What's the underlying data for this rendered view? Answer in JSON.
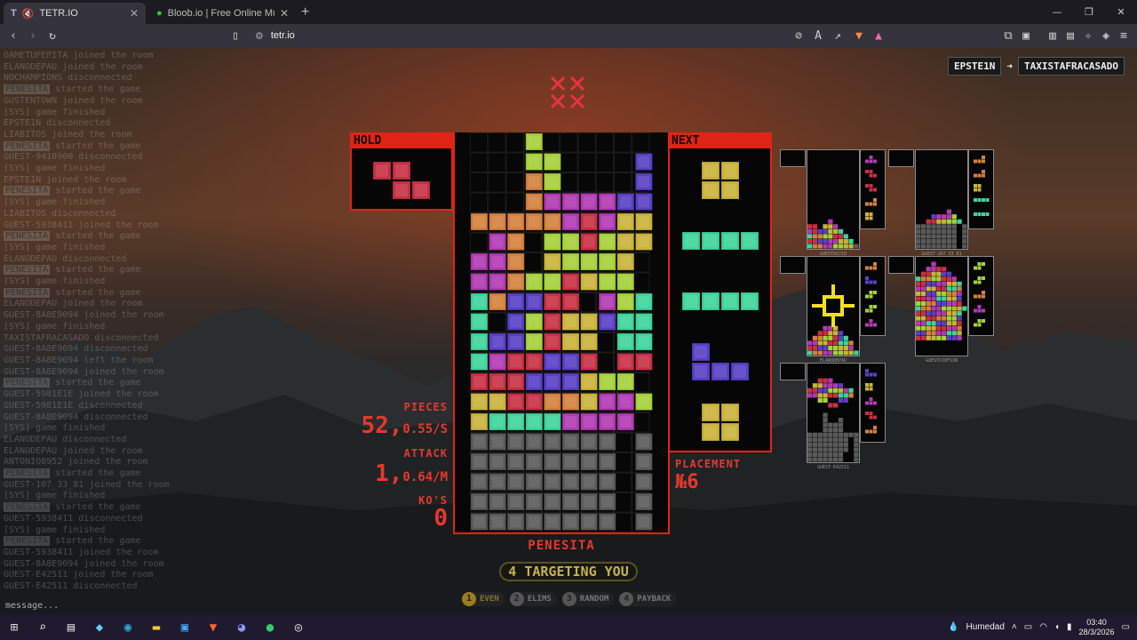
{
  "browser": {
    "tabs": [
      {
        "title": "TETR.IO",
        "active": true
      },
      {
        "title": "Bloob.io | Free Online Multiplayer Ga",
        "active": false
      }
    ],
    "url": "tetr.io",
    "window_controls": [
      "—",
      "❐",
      "✕"
    ]
  },
  "chat": {
    "lines": [
      {
        "tag": "",
        "text": "OAMETUPEPITA joined the room"
      },
      {
        "tag": "",
        "text": "ELANODEPAU joined the room"
      },
      {
        "tag": "",
        "text": "NOCHAMPIONS disconnected"
      },
      {
        "tag": "PENESITA",
        "text": " started the game"
      },
      {
        "tag": "",
        "text": "GUSTENTOWN joined the room"
      },
      {
        "tag": "",
        "text": "[SYS] game finished"
      },
      {
        "tag": "",
        "text": "EPSTE1N disconnected"
      },
      {
        "tag": "",
        "text": "LIABITOS joined the room"
      },
      {
        "tag": "PENESITA",
        "text": " started the game"
      },
      {
        "tag": "",
        "text": "GUEST-9410900 disconnected"
      },
      {
        "tag": "",
        "text": "[SYS] game finished"
      },
      {
        "tag": "",
        "text": "EPSTE1N joined the room"
      },
      {
        "tag": "PENESITA",
        "text": " started the game"
      },
      {
        "tag": "",
        "text": "[SYS] game finished"
      },
      {
        "tag": "",
        "text": "LIABITOS disconnected"
      },
      {
        "tag": "",
        "text": "GUEST-5938411 joined the room"
      },
      {
        "tag": "PENESITA",
        "text": " started the game"
      },
      {
        "tag": "",
        "text": "[SYS] game finished"
      },
      {
        "tag": "",
        "text": "ELANODEPAU disconnected"
      },
      {
        "tag": "PENESITA",
        "text": " started the game"
      },
      {
        "tag": "",
        "text": "[SYS] game finished"
      },
      {
        "tag": "PENESITA",
        "text": " started the game"
      },
      {
        "tag": "",
        "text": "ELANODEPAU joined the room"
      },
      {
        "tag": "",
        "text": "GUEST-8A8E9094 joined the room"
      },
      {
        "tag": "",
        "text": "[SYS] game finished"
      },
      {
        "tag": "",
        "text": "TAXISTAFRACASADO disconnected"
      },
      {
        "tag": "",
        "text": "GUEST-8A8E9094 disconnected"
      },
      {
        "tag": "",
        "text": "GUEST-8A8E9094 left the room"
      },
      {
        "tag": "",
        "text": "GUEST-8A8E9094 joined the room"
      },
      {
        "tag": "PENESITA",
        "text": " started the game"
      },
      {
        "tag": "",
        "text": "GUEST-5981E1E joined the room"
      },
      {
        "tag": "",
        "text": "GUEST-5981E1E disconnected"
      },
      {
        "tag": "",
        "text": "GUEST-8A8E9094 disconnected"
      },
      {
        "tag": "",
        "text": "[SYS] game finished"
      },
      {
        "tag": "",
        "text": "ELANODEPAU disconnected"
      },
      {
        "tag": "",
        "text": "ELANODEPAU joined the room"
      },
      {
        "tag": "",
        "text": "ANTONIO8952 joined the room"
      },
      {
        "tag": "PENESITA",
        "text": " started the game"
      },
      {
        "tag": "",
        "text": "GUEST-107_33_81 joined the room"
      },
      {
        "tag": "",
        "text": "[SYS] game finished"
      },
      {
        "tag": "PENESITA",
        "text": " started the game"
      },
      {
        "tag": "",
        "text": "GUEST-5938411 disconnected"
      },
      {
        "tag": "",
        "text": "[SYS] game finished"
      },
      {
        "tag": "PENESITA",
        "text": " started the game"
      },
      {
        "tag": "",
        "text": "GUEST-5938411 joined the room"
      },
      {
        "tag": "",
        "text": "GUEST-8A8E9094 joined the room"
      },
      {
        "tag": "",
        "text": "GUEST-E42511 joined the room"
      },
      {
        "tag": "",
        "text": "GUEST-E42511 disconnected"
      }
    ],
    "input_placeholder": "message..."
  },
  "target": {
    "from": "EPSTE1N",
    "arrow": "➜",
    "to": "TAXISTAFRACASADO"
  },
  "xmarks": "✕✕✕✕",
  "hold_label": "HOLD",
  "next_label": "NEXT",
  "stats": {
    "pieces_label": "PIECES",
    "pieces_value": "52,",
    "pieces_rate": "0.55/S",
    "attack_label": "ATTACK",
    "attack_value": "1,",
    "attack_rate": "0.64/M",
    "kos_label": "KO'S",
    "kos_value": "0",
    "placement_label": "PLACEMENT",
    "placement_value": "№6"
  },
  "player_name": "PENESITA",
  "targeting_text": "4 TARGETING YOU",
  "strategies": [
    {
      "num": "1",
      "label": "EVEN",
      "selected": true
    },
    {
      "num": "2",
      "label": "ELIMS",
      "selected": false
    },
    {
      "num": "3",
      "label": "RANDOM",
      "selected": false
    },
    {
      "num": "4",
      "label": "PAYBACK",
      "selected": false
    }
  ],
  "colors": {
    "Z": "#c83044",
    "S": "#a6d13a",
    "L": "#d4803e",
    "J": "#5a3fc6",
    "T": "#b23ab3",
    "O": "#c9b33a",
    "I": "#3fd49b",
    "G": "#5a5a5a",
    "accent": "#e02415"
  },
  "board": {
    "cols": 10,
    "rows": [
      "..........",
      "...S......",
      "...SS....J",
      "...LS....J",
      "...LTTTTJJ",
      "LLLLLTZTOO",
      ".TL.SSZSOO",
      "TTL.OSSSO.",
      "TTLSSZOSS.",
      "ILJJZZ.TSI",
      "I.JSZOOJII",
      "IJJSZOO.II",
      "ITZZJJZ.ZZ",
      "ZZZJJJOSS.",
      "OOZZLLOTTS",
      "OIIIITTTT.",
      "GGGGGGGG.G",
      "GGGGGGGG.G",
      "GGGGGGGG.G",
      "GGGGGGGG.G",
      "GGGGGGGG.G"
    ]
  },
  "hold_piece": "Z",
  "queue": [
    "O",
    "I",
    "I",
    "J",
    "O"
  ],
  "opponent_names": [
    "GUESTDS710",
    "GUEST-107_33_81",
    "ELANODEPAU",
    "GUESTCOOFSIN",
    "GUEST-E42511"
  ],
  "taskbar": {
    "weather": "Humedad",
    "time": "03:40",
    "date": "28/3/2026"
  }
}
